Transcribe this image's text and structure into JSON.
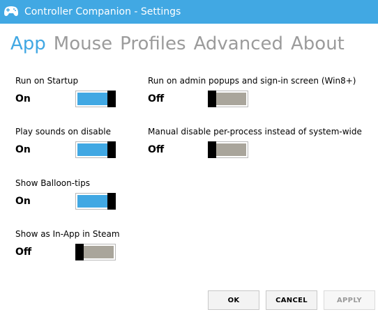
{
  "window": {
    "title": "Controller Companion - Settings",
    "icon": "gamepad-icon",
    "accent_color": "#41a8e3"
  },
  "tabs": [
    {
      "label": "App",
      "active": true
    },
    {
      "label": "Mouse",
      "active": false
    },
    {
      "label": "Profiles",
      "active": false
    },
    {
      "label": "Advanced",
      "active": false
    },
    {
      "label": "About",
      "active": false
    }
  ],
  "settings": {
    "run_on_startup": {
      "label": "Run on Startup",
      "state": "On",
      "enabled": true
    },
    "play_sounds": {
      "label": "Play sounds on disable",
      "state": "On",
      "enabled": true
    },
    "balloon_tips": {
      "label": "Show Balloon-tips",
      "state": "On",
      "enabled": true
    },
    "in_app_steam": {
      "label": "Show as In-App in Steam",
      "state": "Off",
      "enabled": false
    },
    "admin_popups": {
      "label": "Run on admin popups and sign-in screen (Win8+)",
      "state": "Off",
      "enabled": false
    },
    "manual_disable": {
      "label": "Manual disable per-process instead of system-wide",
      "state": "Off",
      "enabled": false
    }
  },
  "buttons": {
    "ok": "OK",
    "cancel": "CANCEL",
    "apply": "APPLY"
  }
}
